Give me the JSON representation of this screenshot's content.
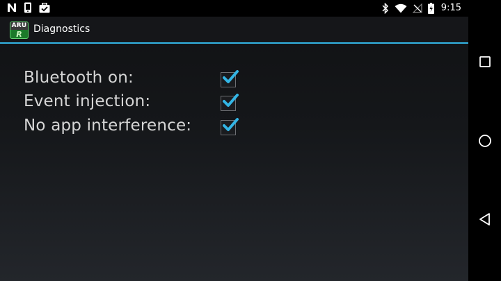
{
  "status_bar": {
    "time": "9:15",
    "left_icons": [
      "n-notification-icon",
      "phone-icon",
      "briefcase-check-icon"
    ],
    "right_icons": [
      "bluetooth-icon",
      "wifi-icon",
      "no-signal-icon",
      "battery-icon"
    ]
  },
  "action_bar": {
    "logo_top": "ARU",
    "logo_bottom": "R",
    "title": "Diagnostics"
  },
  "checks": [
    {
      "label": "Bluetooth on:",
      "checked": true
    },
    {
      "label": "Event injection:",
      "checked": true
    },
    {
      "label": "No app interference:",
      "checked": true
    }
  ],
  "nav_bar": {
    "buttons": [
      "recents-icon",
      "home-icon",
      "back-icon"
    ]
  },
  "colors": {
    "accent": "#33b5e5",
    "checkmark": "#33b5e5",
    "label_text": "#d6d6d6"
  }
}
